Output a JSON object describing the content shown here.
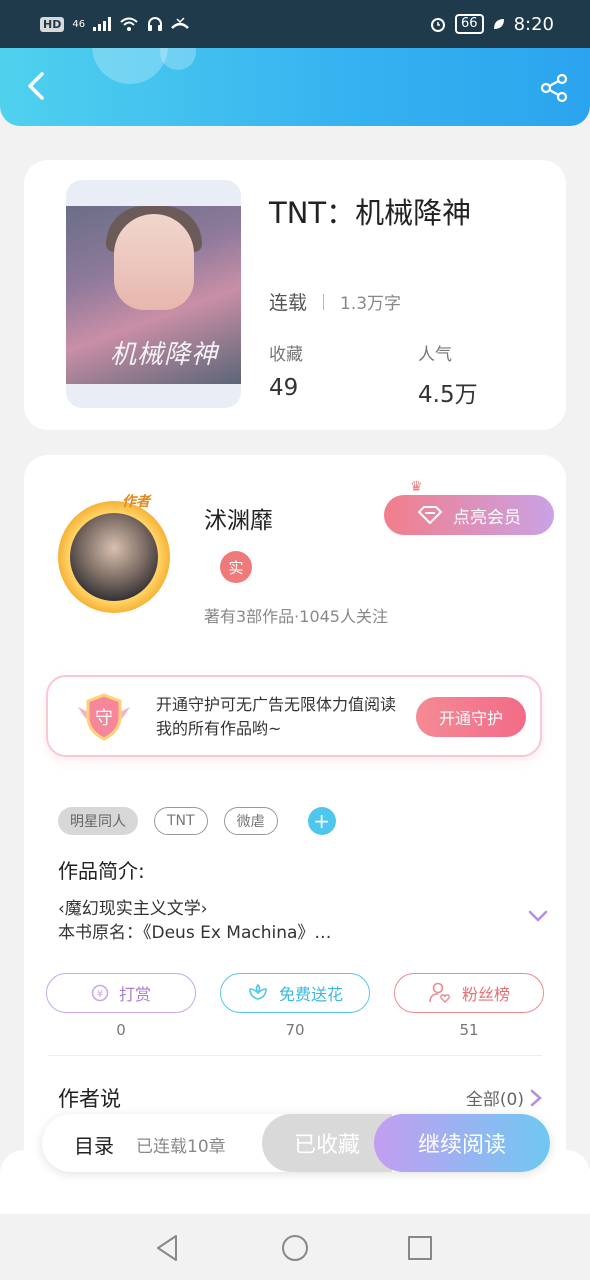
{
  "status_bar": {
    "hd_label": "HD",
    "network_label": "46",
    "battery_level": "66",
    "time": "8:20",
    "icons": [
      "signal-icon",
      "wifi-icon",
      "headset-icon",
      "missed-call-icon",
      "alarm-icon",
      "battery-icon",
      "leaf-icon"
    ]
  },
  "header": {
    "back_icon": "chevron-left-icon",
    "share_icon": "share-icon",
    "gradient": [
      "#4fd1ee",
      "#2ba4ee"
    ]
  },
  "book": {
    "cover_title_art": "机械降神",
    "title": "TNT：机械降神",
    "status": "连载",
    "word_count": "1.3万字",
    "stats": [
      {
        "label": "收藏",
        "value": "49"
      },
      {
        "label": "人气",
        "value": "4.5万"
      }
    ]
  },
  "author": {
    "avatar_tag": "作者",
    "name": "沭渊靡",
    "verified_label": "实",
    "stats_text": "著有3部作品·1045人关注",
    "vip_button": "点亮会员"
  },
  "guard_banner": {
    "icon_text": "守",
    "text": "开通守护可无广告无限体力值阅读我的所有作品哟~",
    "button": "开通守护"
  },
  "tags": [
    "明星同人",
    "TNT",
    "微虐"
  ],
  "intro": {
    "label": "作品简介:",
    "line1": "‹魔幻现实主义文学›",
    "line2": "本书原名：《Deus Ex Machina》…"
  },
  "actions": [
    {
      "label": "打赏",
      "count": "0",
      "icon": "coin-icon"
    },
    {
      "label": "免费送花",
      "count": "70",
      "icon": "flower-icon"
    },
    {
      "label": "粉丝榜",
      "count": "51",
      "icon": "fan-heart-icon"
    }
  ],
  "author_says": {
    "label": "作者说",
    "all_link": "全部(0)"
  },
  "bottom_bar": {
    "toc": "目录",
    "chapters": "已连载10章",
    "collected": "已收藏",
    "continue": "继续阅读"
  },
  "colors": {
    "accent": "#35b2f0",
    "vip_gradient": [
      "#f27e8a",
      "#c9a2e6"
    ],
    "continue_gradient": [
      "#c39ef0",
      "#6fc8f2"
    ]
  }
}
